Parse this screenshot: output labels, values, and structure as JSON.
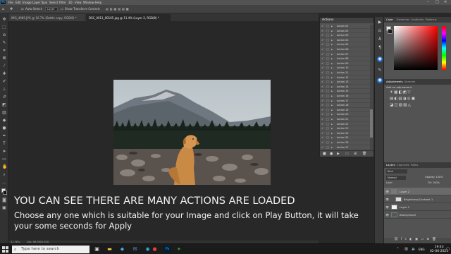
{
  "menubar": {
    "app_icon": "Ps",
    "items": [
      "File",
      "Edit",
      "Image",
      "Layer",
      "Type",
      "Select",
      "Filter",
      "3D",
      "View",
      "Window",
      "Help"
    ]
  },
  "optionsbar": {
    "auto_select": "Auto-Select:",
    "auto_select_value": "Layer",
    "show_transform": "Show Transform Controls"
  },
  "doc_tabs": [
    {
      "label": "IMG_4985.JPG @ 16.7% (Bottle copy, RGB/8) *",
      "active": false
    },
    {
      "label": "DSC_0011_00165.jpg @ 11.4% (Layer 2, RGB/8) *",
      "active": true
    }
  ],
  "status": {
    "zoom": "11.38%",
    "doc": "Doc: 68.5M/1.63G"
  },
  "actions_panel": {
    "title": "Actions",
    "items": [
      "Action 01",
      "Action 02",
      "Action 03",
      "Action 04",
      "Action 05",
      "Action 06",
      "Action 07",
      "Action 08",
      "Action 09",
      "Action 10",
      "Action 11",
      "Action 12",
      "Action 13",
      "Action 14",
      "Action 15",
      "Action 16",
      "Action 17",
      "Action 18",
      "Action 19",
      "Action 20",
      "Action 21",
      "Action 22",
      "Action 23",
      "Action 24",
      "Action 25",
      "Action 26",
      "Action 27"
    ]
  },
  "color_panel": {
    "tabs": [
      "Color",
      "Swatches",
      "Gradients",
      "Patterns"
    ]
  },
  "adjustments_panel": {
    "tabs": [
      "Adjustments",
      "Libraries"
    ],
    "add_label": "Add an adjustment"
  },
  "layers_panel": {
    "tabs": [
      "Layers",
      "Channels",
      "Paths"
    ],
    "kind": "Kind",
    "blend": "Normal",
    "opacity": "Opacity: 100%",
    "lock": "Lock:",
    "fill": "Fill: 100%",
    "layers": [
      "Layer 2",
      "Brightness/Contrast 1",
      "Layer 1",
      "Background"
    ]
  },
  "captions": {
    "line1": "YOU CAN SEE THERE ARE MANY ACTIONS ARE LOADED",
    "line2": "Choose any one which is suitable for your Image and click on Play Button, it will take your some seconds for Apply"
  },
  "taskbar": {
    "search_placeholder": "Type here to search",
    "lang": "ENG",
    "time": "19:43",
    "date": "02-06-2021"
  },
  "colors": {
    "accent": "#31a8ff",
    "panel": "#535353",
    "canvas": "#282828"
  }
}
